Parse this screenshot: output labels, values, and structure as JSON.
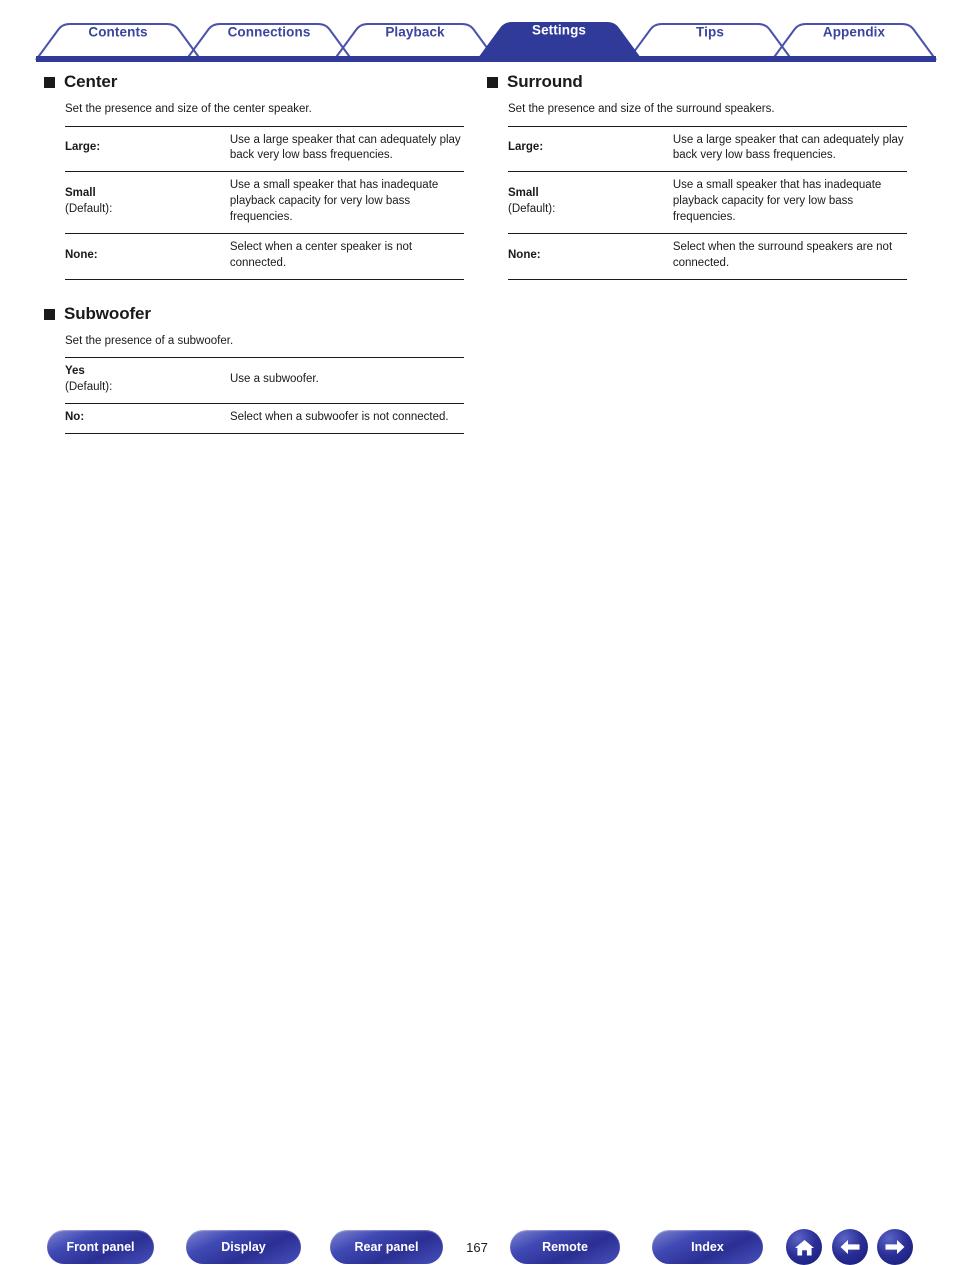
{
  "tabs": [
    {
      "label": "Contents",
      "active": false
    },
    {
      "label": "Connections",
      "active": false
    },
    {
      "label": "Playback",
      "active": false
    },
    {
      "label": "Settings",
      "active": true
    },
    {
      "label": "Tips",
      "active": false
    },
    {
      "label": "Appendix",
      "active": false
    }
  ],
  "columns": {
    "left": [
      {
        "title": "Center",
        "description": "Set the presence and size of the center speaker.",
        "rows": [
          {
            "key": "Large:",
            "default_note": "",
            "value": "Use a large speaker that can adequately play back very low bass frequencies."
          },
          {
            "key": "Small",
            "default_note": "(Default):",
            "value": "Use a small speaker that has inadequate playback capacity for very low bass frequencies."
          },
          {
            "key": "None:",
            "default_note": "",
            "value": "Select when a center speaker is not connected."
          }
        ]
      },
      {
        "title": "Subwoofer",
        "description": "Set the presence of a subwoofer.",
        "rows": [
          {
            "key": "Yes",
            "default_note": "(Default):",
            "value": "Use a subwoofer."
          },
          {
            "key": "No:",
            "default_note": "",
            "value": "Select when a subwoofer is not connected."
          }
        ]
      }
    ],
    "right": [
      {
        "title": "Surround",
        "description": "Set the presence and size of the surround speakers.",
        "rows": [
          {
            "key": "Large:",
            "default_note": "",
            "value": "Use a large speaker that can adequately play back very low bass frequencies."
          },
          {
            "key": "Small",
            "default_note": "(Default):",
            "value": "Use a small speaker that has inadequate playback capacity for very low bass frequencies."
          },
          {
            "key": "None:",
            "default_note": "",
            "value": "Select when the surround speakers are not connected."
          }
        ]
      }
    ]
  },
  "footer": {
    "buttons": [
      {
        "label": "Front panel"
      },
      {
        "label": "Display"
      },
      {
        "label": "Rear panel"
      },
      {
        "label": "Remote"
      },
      {
        "label": "Index"
      }
    ],
    "page_number": "167",
    "icons": [
      {
        "name": "home-icon"
      },
      {
        "name": "arrow-left-icon"
      },
      {
        "name": "arrow-right-icon"
      }
    ]
  },
  "colors": {
    "brand_blue": "#3b44a0",
    "active_tab_blue": "#2f3a99",
    "text": "#1a1a1a"
  }
}
